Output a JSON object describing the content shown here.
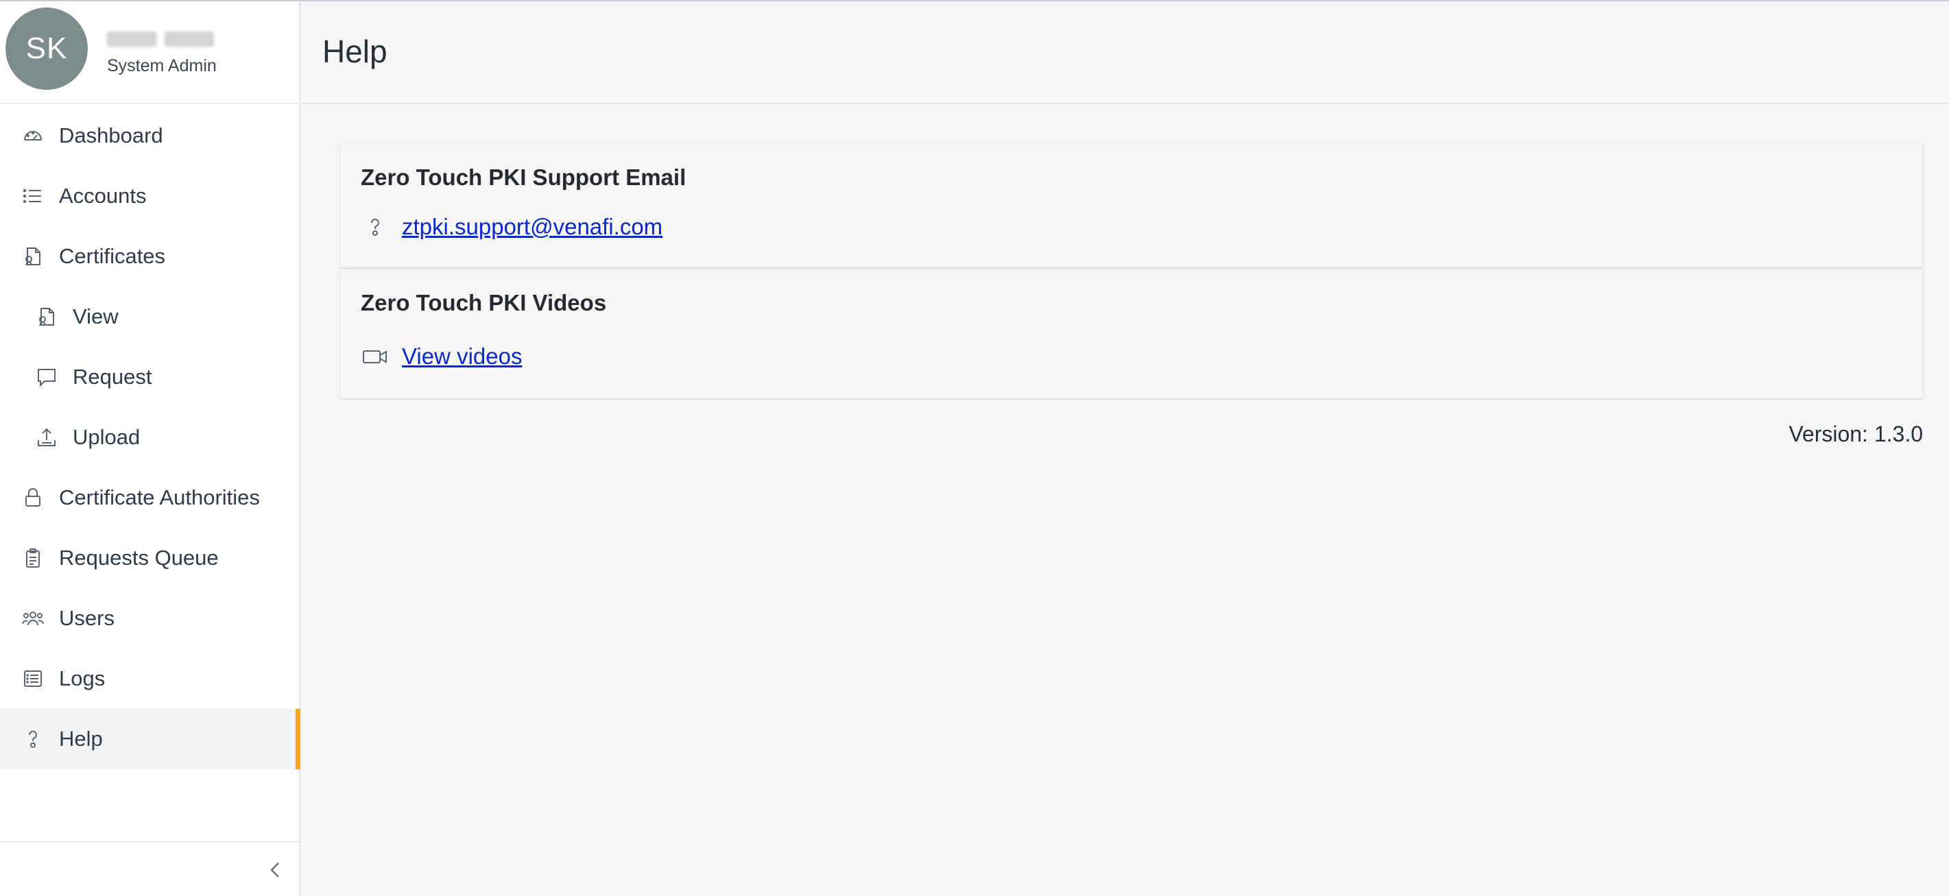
{
  "profile": {
    "initials": "SK",
    "role": "System Admin"
  },
  "nav": {
    "items": [
      {
        "label": "Dashboard",
        "icon": "gauge-icon"
      },
      {
        "label": "Accounts",
        "icon": "list-icon"
      },
      {
        "label": "Certificates",
        "icon": "certificate-icon"
      },
      {
        "label": "View",
        "icon": "certificate-view-icon"
      },
      {
        "label": "Request",
        "icon": "speech-bubble-icon"
      },
      {
        "label": "Upload",
        "icon": "upload-icon"
      },
      {
        "label": "Certificate Authorities",
        "icon": "lock-icon"
      },
      {
        "label": "Requests Queue",
        "icon": "clipboard-icon"
      },
      {
        "label": "Users",
        "icon": "users-icon"
      },
      {
        "label": "Logs",
        "icon": "log-list-icon"
      },
      {
        "label": "Help",
        "icon": "help-icon"
      }
    ],
    "active": "Help"
  },
  "header": {
    "title": "Help"
  },
  "support": {
    "title": "Zero Touch PKI Support Email",
    "email": "ztpki.support@venafi.com"
  },
  "videos": {
    "title": "Zero Touch PKI Videos",
    "link_label": "View videos"
  },
  "footer": {
    "version": "Version: 1.3.0"
  },
  "colors": {
    "accent": "#f6a623",
    "link": "#0a28c8",
    "avatar": "#7e8d8c"
  }
}
